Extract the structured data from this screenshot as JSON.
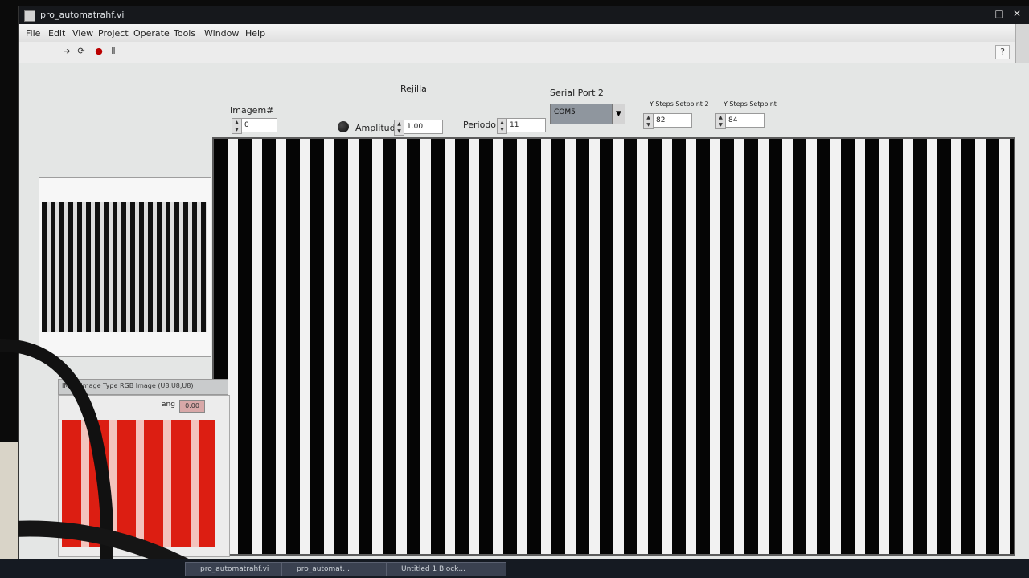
{
  "window": {
    "title": "pro_automatrahf.vi"
  },
  "menu": [
    "File",
    "Edit",
    "View",
    "Project",
    "Operate",
    "Tools",
    "Window",
    "Help"
  ],
  "toolbar": {
    "icons": [
      "run-arrow-icon",
      "run-continuous-icon",
      "abort-icon",
      "pause-icon"
    ]
  },
  "controls": {
    "imagem": {
      "label": "Imagem#",
      "value": "0"
    },
    "group_title": "Rejilla",
    "amplitud": {
      "label": "Amplitud",
      "value": "1.00"
    },
    "periodo": {
      "label": "Periodo",
      "value": "11"
    },
    "serial": {
      "label": "Serial Port 2",
      "value": "COM5"
    },
    "setpoint2": {
      "label": "Y Steps Setpoint 2",
      "value": "82"
    },
    "setpoint": {
      "label": "Y Steps Setpoint",
      "value": "84"
    }
  },
  "image_panel": {
    "label": "IMAQ Image Type RGB Image (U8,U8,U8)",
    "field_label": "ang",
    "field_value": "0.00"
  },
  "taskbar": [
    "pro_automatrahf.vi",
    "pro_automat...",
    "Untitled 1 Block..."
  ]
}
